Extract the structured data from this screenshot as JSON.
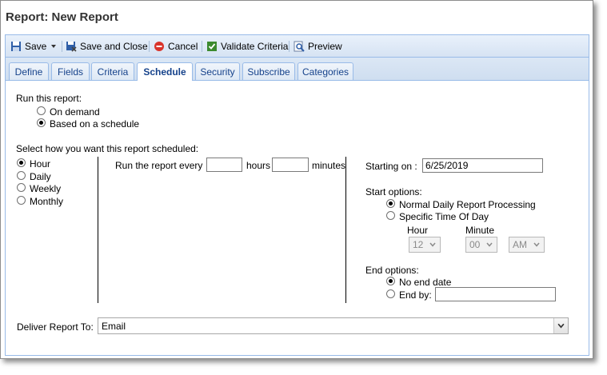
{
  "window": {
    "title": "Report: New Report"
  },
  "toolbar": {
    "save_label": "Save",
    "save_close_label": "Save and Close",
    "cancel_label": "Cancel",
    "validate_label": "Validate Criteria",
    "preview_label": "Preview"
  },
  "tabs": [
    {
      "label": "Define"
    },
    {
      "label": "Fields"
    },
    {
      "label": "Criteria"
    },
    {
      "label": "Schedule"
    },
    {
      "label": "Security"
    },
    {
      "label": "Subscribe"
    },
    {
      "label": "Categories"
    }
  ],
  "active_tab": "Schedule",
  "run": {
    "label": "Run this report:",
    "options": [
      "On demand",
      "Based on a schedule"
    ],
    "selected": "Based on a schedule"
  },
  "frequency": {
    "label": "Select how you want this report scheduled:",
    "options": [
      "Hour",
      "Daily",
      "Weekly",
      "Monthly"
    ],
    "selected": "Hour"
  },
  "interval": {
    "prefix": "Run the report every",
    "hours_label": "hours",
    "minutes_label": "minutes",
    "hours_value": "",
    "minutes_value": ""
  },
  "start": {
    "label": "Starting on :",
    "date": "6/25/2019",
    "options_label": "Start options:",
    "options": [
      "Normal Daily Report Processing",
      "Specific Time Of Day"
    ],
    "selected": "Normal Daily Report Processing",
    "hour_label": "Hour",
    "minute_label": "Minute",
    "hour_value": "12",
    "minute_value": "00",
    "ampm_value": "AM"
  },
  "end": {
    "label": "End options:",
    "options": [
      "No end date",
      "End by:"
    ],
    "selected": "No end date",
    "end_by_value": ""
  },
  "deliver": {
    "label": "Deliver Report To:",
    "value": "Email"
  },
  "colors": {
    "tab_text": "#15428b",
    "border": "#99bbe8",
    "cancel_red": "#d9342b",
    "validate_green": "#3c8a2e"
  }
}
